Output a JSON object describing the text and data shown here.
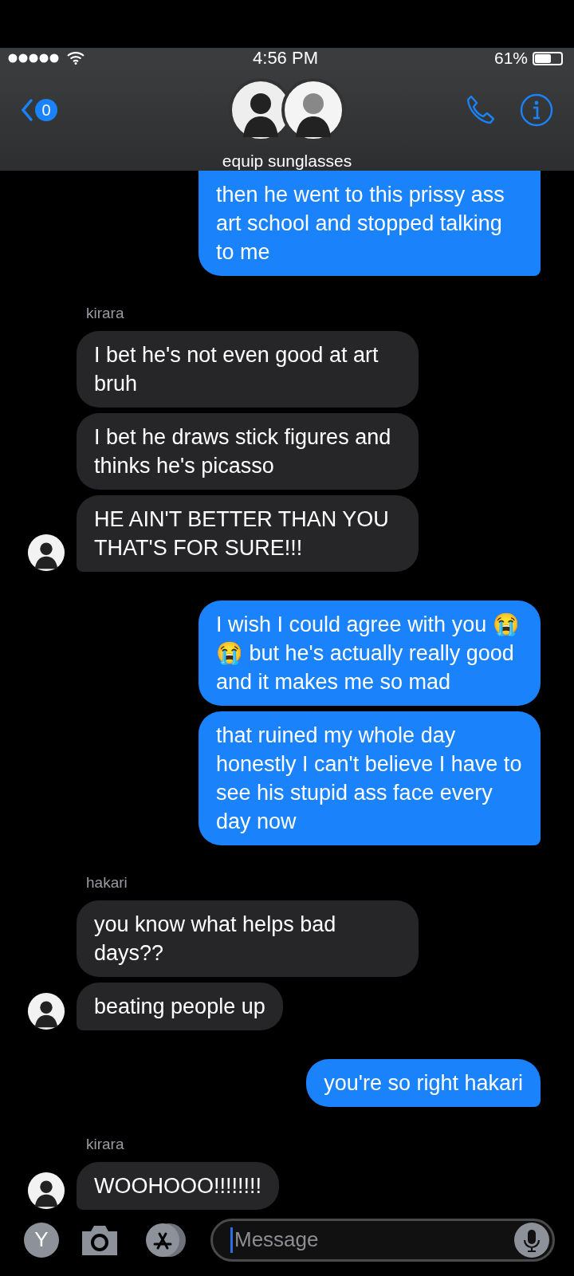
{
  "status_bar": {
    "time": "4:56 PM",
    "battery_text": "61%"
  },
  "header": {
    "back_badge": "0",
    "title": "equip sunglasses"
  },
  "groups": [
    {
      "kind": "sent",
      "messages": [
        "then he went to this prissy ass art school and stopped talking to me"
      ]
    },
    {
      "kind": "received",
      "sender": "kirara",
      "messages": [
        "I bet he's not even good at art bruh",
        "I bet he draws stick figures and thinks he's picasso",
        "HE AIN'T BETTER THAN YOU THAT'S FOR SURE!!!"
      ]
    },
    {
      "kind": "sent",
      "messages": [
        "I wish I could agree with you 😭😭 but he's actually really good and it makes me so mad",
        "that ruined my whole day honestly I can't believe I have to see his stupid ass face every day now"
      ]
    },
    {
      "kind": "received",
      "sender": "hakari",
      "messages": [
        "you know what helps bad days??",
        "beating people up"
      ]
    },
    {
      "kind": "sent",
      "messages": [
        "you're so right hakari"
      ]
    },
    {
      "kind": "received",
      "sender": "kirara",
      "messages": [
        "WOOHOOO!!!!!!!!"
      ]
    }
  ],
  "composer": {
    "profile_letter": "Y",
    "placeholder": "Message"
  }
}
